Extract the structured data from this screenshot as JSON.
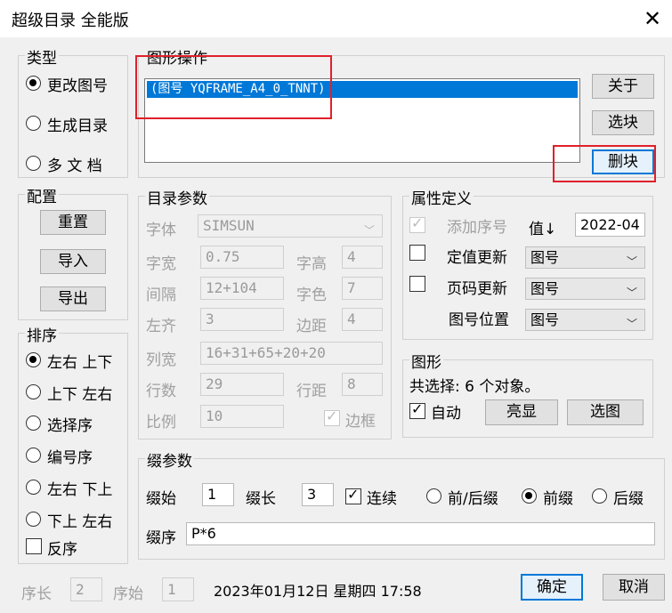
{
  "window": {
    "title": "超级目录 全能版",
    "close_glyph": "✕"
  },
  "type_group": {
    "legend": "类型",
    "options": [
      {
        "label": "更改图号",
        "selected": true
      },
      {
        "label": "生成目录",
        "selected": false
      },
      {
        "label": "多 文 档",
        "selected": false
      }
    ]
  },
  "graphics_ops": {
    "legend": "图形操作",
    "list_item": "(图号 YQFRAME_A4_0_TNNT)",
    "about_button": "关于",
    "select_block_button": "选块",
    "delete_block_button": "删块"
  },
  "config_group": {
    "legend": "配置",
    "reset_button": "重置",
    "import_button": "导入",
    "export_button": "导出"
  },
  "sort_group": {
    "legend": "排序",
    "options": [
      {
        "label": "左右  上下",
        "selected": true
      },
      {
        "label": "上下  左右",
        "selected": false
      },
      {
        "label": "选择序",
        "selected": false
      },
      {
        "label": "编号序",
        "selected": false
      },
      {
        "label": "左右  下上",
        "selected": false
      },
      {
        "label": "下上  左右",
        "selected": false
      }
    ],
    "reverse_label": "反序"
  },
  "catalog_params": {
    "legend": "目录参数",
    "font_label": "字体",
    "font_value": "SIMSUN",
    "char_width_label": "字宽",
    "char_width_value": "0.75",
    "char_height_label": "字高",
    "char_height_value": "4",
    "spacing_label": "间隔",
    "spacing_value": "12+104",
    "char_color_label": "字色",
    "char_color_value": "7",
    "left_align_label": "左齐",
    "left_align_value": "3",
    "margin_label": "边距",
    "margin_value": "4",
    "col_width_label": "列宽",
    "col_width_value": "16+31+65+20+20",
    "row_count_label": "行数",
    "row_count_value": "29",
    "row_spacing_label": "行距",
    "row_spacing_value": "8",
    "scale_label": "比例",
    "scale_value": "10",
    "border_label": "边框"
  },
  "attr_def": {
    "legend": "属性定义",
    "add_seq_label": "添加序号",
    "value_label": "值↓",
    "value_input": "2022-04",
    "fixed_update_label": "定值更新",
    "fixed_update_select": "图号",
    "page_update_label": "页码更新",
    "page_update_select": "图号",
    "drawing_pos_label": "图号位置",
    "drawing_pos_select": "图号"
  },
  "shape_group": {
    "legend": "图形",
    "selection_text": "共选择: 6 个对象。",
    "auto_label": "自动",
    "highlight_button": "亮显",
    "select_shape_button": "选图"
  },
  "level_params": {
    "legend": "缀参数",
    "start_label": "缀始",
    "start_value": "1",
    "length_label": "缀长",
    "length_value": "3",
    "continuous_label": "连续",
    "prefix_suffix_label": "前/后缀",
    "prefix_label": "前缀",
    "suffix_label": "后缀",
    "order_label": "缀序",
    "order_value": "P*6"
  },
  "footer": {
    "seq_len_label": "序长",
    "seq_len_value": "2",
    "seq_start_label": "序始",
    "seq_start_value": "1",
    "datetime": "2023年01月12日  星期四  17:58",
    "ok_button": "确定",
    "cancel_button": "取消"
  },
  "colors": {
    "accent": "#0078d7",
    "highlight_box": "#e0202a",
    "list_selection": "#0078d7"
  }
}
